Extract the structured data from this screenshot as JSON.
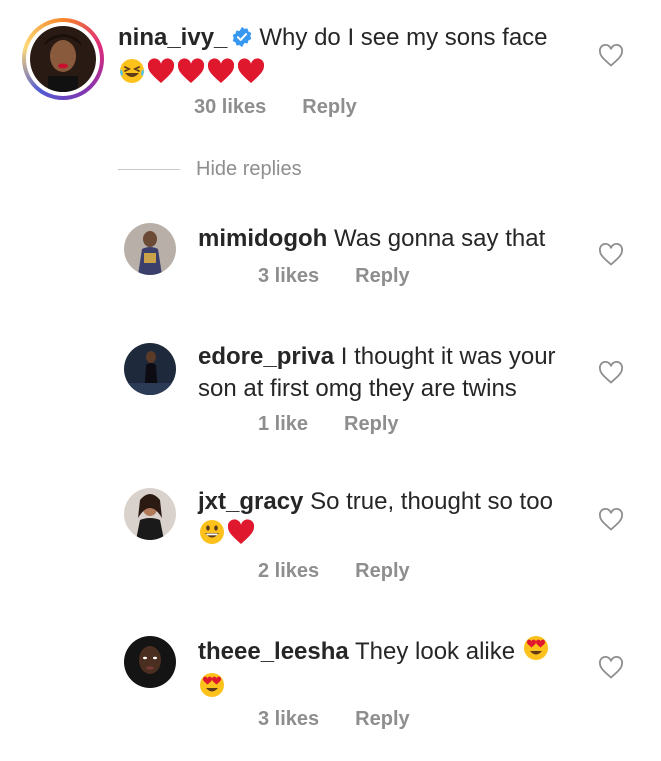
{
  "main_comment": {
    "username": "nina_ivy_",
    "text": "Why do I see my sons face",
    "emojis": [
      "laughing-tears",
      "red-heart",
      "red-heart",
      "red-heart",
      "red-heart"
    ],
    "likes": "30 likes",
    "reply_label": "Reply"
  },
  "hide_replies_label": "Hide replies",
  "replies": [
    {
      "username": "mimidogoh",
      "text_line1": "Was gonna say that",
      "likes": "3 likes",
      "reply_label": "Reply"
    },
    {
      "username": "edore_priva",
      "text_line1": "I thought it was your",
      "text_line2": "son at first omg they are twins",
      "likes": "1 like",
      "reply_label": "Reply"
    },
    {
      "username": "jxt_gracy",
      "text_line1": "So true, thought so too",
      "emojis": [
        "grinning-face",
        "red-heart"
      ],
      "likes": "2 likes",
      "reply_label": "Reply"
    },
    {
      "username": "theee_leesha",
      "text_line1": "They look alike",
      "emojis": [
        "heart-eyes",
        "heart-eyes"
      ],
      "likes": "3 likes",
      "reply_label": "Reply"
    }
  ],
  "colors": {
    "text": "#262626",
    "muted": "#8e8e8e",
    "verified": "#3897f0",
    "heart": "#e0182d"
  }
}
